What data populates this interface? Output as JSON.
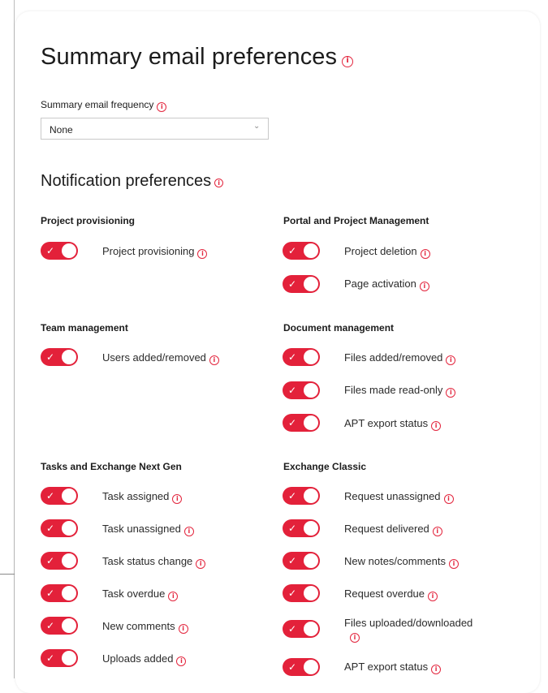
{
  "page": {
    "title": "Summary email preferences",
    "frequency_label": "Summary email frequency",
    "frequency_value": "None",
    "notification_title": "Notification preferences"
  },
  "colors": {
    "accent": "#e3213a",
    "toggle_on": "#e3213a",
    "text": "#1c1c1c"
  },
  "icons": {
    "info": "info-circle-icon",
    "dropdown": "chevron-down-icon",
    "check": "check-icon"
  },
  "groups": {
    "project_provisioning": {
      "title": "Project provisioning",
      "items": [
        {
          "label": "Project provisioning",
          "enabled": true
        }
      ]
    },
    "portal_pm": {
      "title": "Portal and Project Management",
      "items": [
        {
          "label": "Project deletion",
          "enabled": true
        },
        {
          "label": "Page activation",
          "enabled": true
        }
      ]
    },
    "team": {
      "title": "Team management",
      "items": [
        {
          "label": "Users added/removed",
          "enabled": true
        }
      ]
    },
    "document": {
      "title": "Document management",
      "items": [
        {
          "label": "Files added/removed",
          "enabled": true
        },
        {
          "label": "Files made read-only",
          "enabled": true
        },
        {
          "label": "APT export status",
          "enabled": true
        }
      ]
    },
    "tasks": {
      "title": "Tasks and Exchange Next Gen",
      "items": [
        {
          "label": "Task assigned",
          "enabled": true
        },
        {
          "label": "Task unassigned",
          "enabled": true
        },
        {
          "label": "Task status change",
          "enabled": true
        },
        {
          "label": "Task overdue",
          "enabled": true
        },
        {
          "label": "New comments",
          "enabled": true
        },
        {
          "label": "Uploads added",
          "enabled": true
        }
      ]
    },
    "exchange": {
      "title": "Exchange Classic",
      "items": [
        {
          "label": "Request unassigned",
          "enabled": true
        },
        {
          "label": "Request delivered",
          "enabled": true
        },
        {
          "label": "New notes/comments",
          "enabled": true
        },
        {
          "label": "Request overdue",
          "enabled": true
        },
        {
          "label": "Files uploaded/downloaded",
          "enabled": true
        },
        {
          "label": "APT export status",
          "enabled": true
        }
      ]
    }
  }
}
